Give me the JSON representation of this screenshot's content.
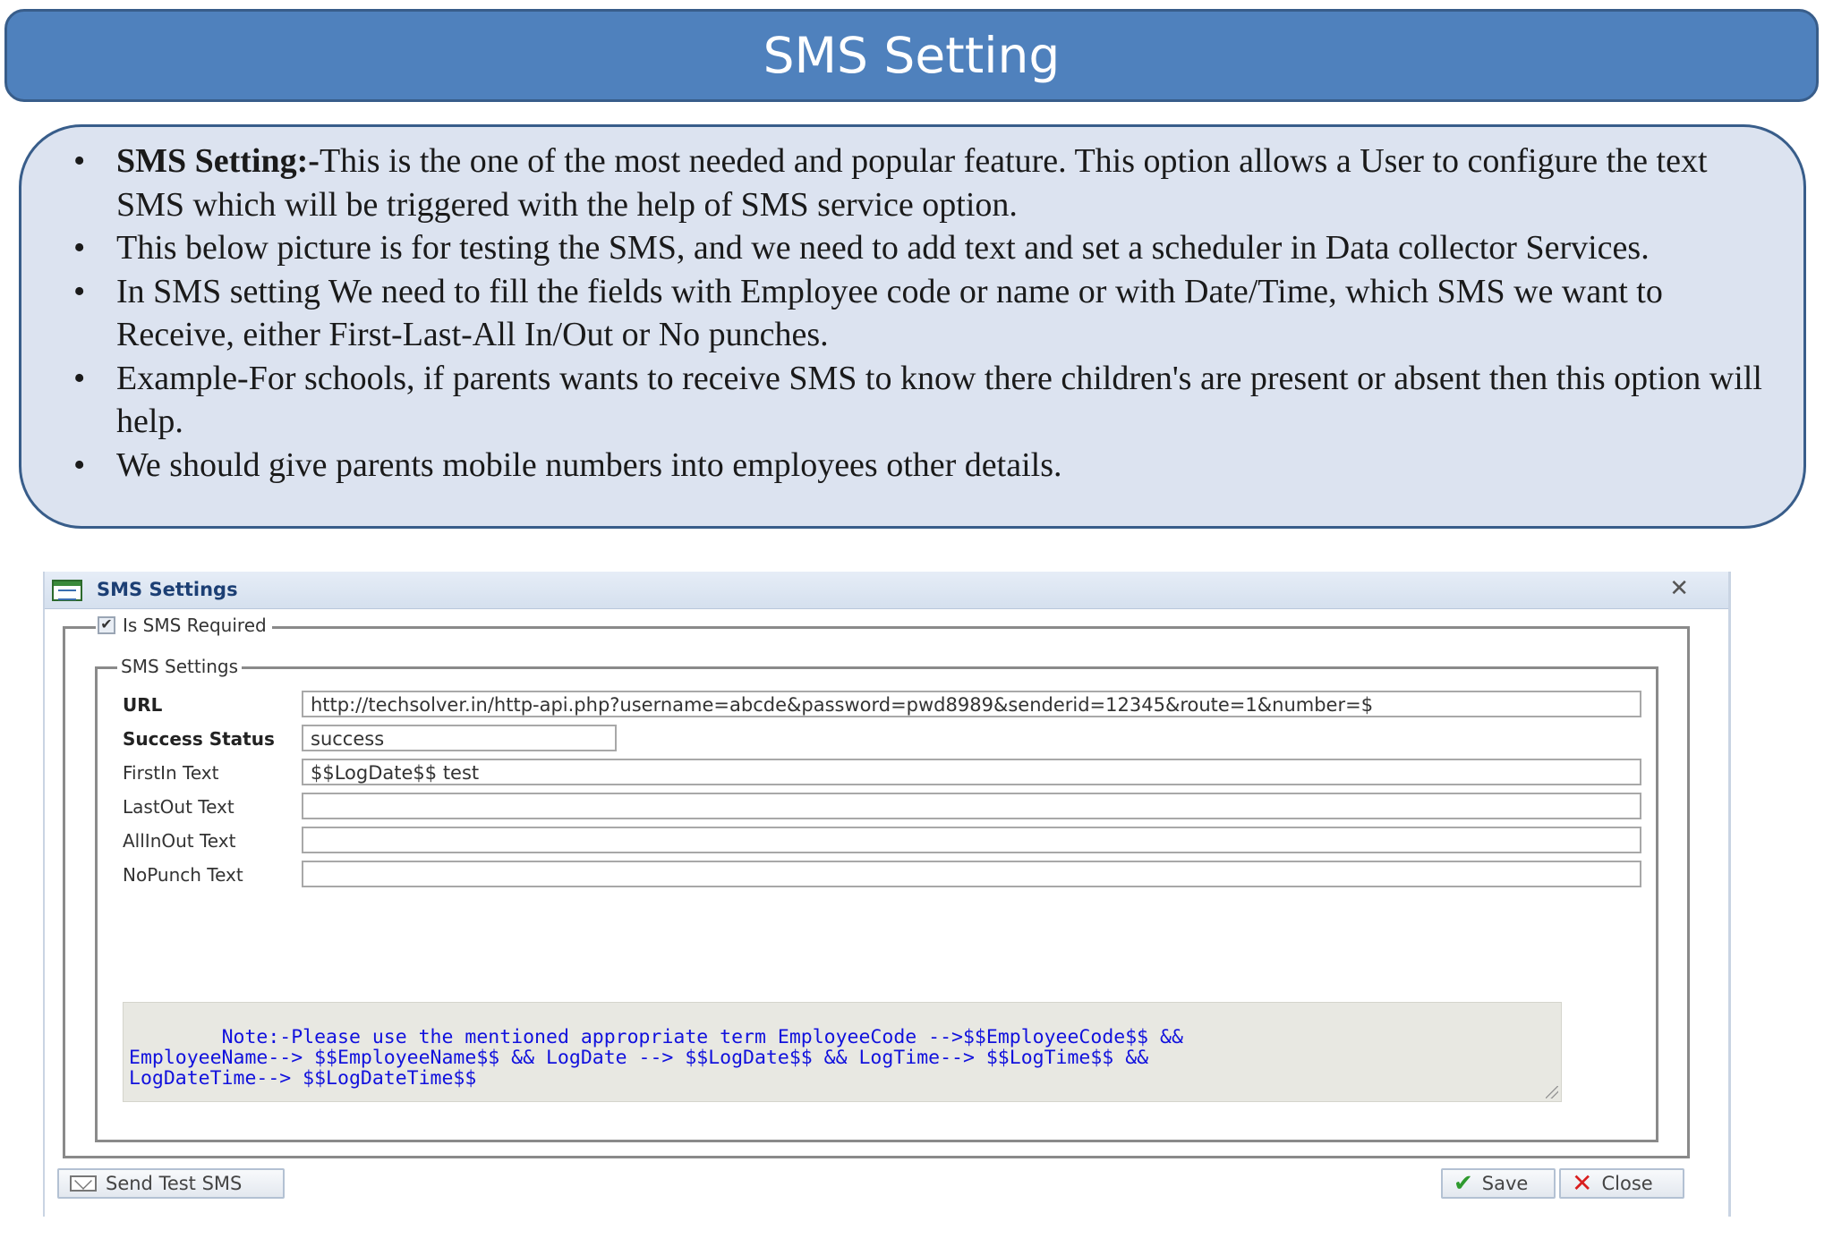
{
  "slide": {
    "title": "SMS Setting",
    "bullets": [
      {
        "bold": "SMS Setting:-",
        "text": "This is the one of the most needed and popular feature. This option allows a User to configure the text SMS which will be triggered with the help of SMS service option."
      },
      {
        "bold": "",
        "text": "This below picture is for testing the SMS, and we need to add text and set a scheduler in Data collector Services."
      },
      {
        "bold": "",
        "text": "In SMS setting We need to fill the fields with Employee code or name or with Date/Time, which SMS we want to Receive, either First-Last-All In/Out or No punches."
      },
      {
        "bold": "",
        "text": "Example-For schools, if parents wants to receive SMS to know there children's are present or absent then this option will help."
      },
      {
        "bold": "",
        "text": "We should give parents mobile numbers into employees other details."
      }
    ]
  },
  "dialog": {
    "title": "SMS Settings",
    "close_glyph": "✕",
    "is_sms_required": {
      "label": "Is SMS Required",
      "checked": true
    },
    "settings_legend": "SMS Settings",
    "fields": {
      "url": {
        "label": "URL",
        "value": "http://techsolver.in/http-api.php?username=abcde&password=pwd8989&senderid=12345&route=1&number=$"
      },
      "success_status": {
        "label": "Success Status",
        "value": "success"
      },
      "firstin_text": {
        "label": "FirstIn Text",
        "value": "$$LogDate$$ test"
      },
      "lastout_text": {
        "label": "LastOut Text",
        "value": ""
      },
      "allinout_text": {
        "label": "AllInOut Text",
        "value": ""
      },
      "nopunch_text": {
        "label": "NoPunch Text",
        "value": ""
      }
    },
    "note": "Note:-Please use the mentioned appropriate term EmployeeCode -->$$EmployeeCode$$ &&\nEmployeeName--> $$EmployeeName$$ && LogDate --> $$LogDate$$ && LogTime--> $$LogTime$$ &&\nLogDateTime--> $$LogDateTime$$",
    "buttons": {
      "send_test_sms": "Send Test SMS",
      "save": "Save",
      "close": "Close"
    }
  },
  "colors": {
    "banner": "#4f81bd",
    "panel": "#dce3f0",
    "border": "#385d8a",
    "note_text": "#1111dd"
  }
}
